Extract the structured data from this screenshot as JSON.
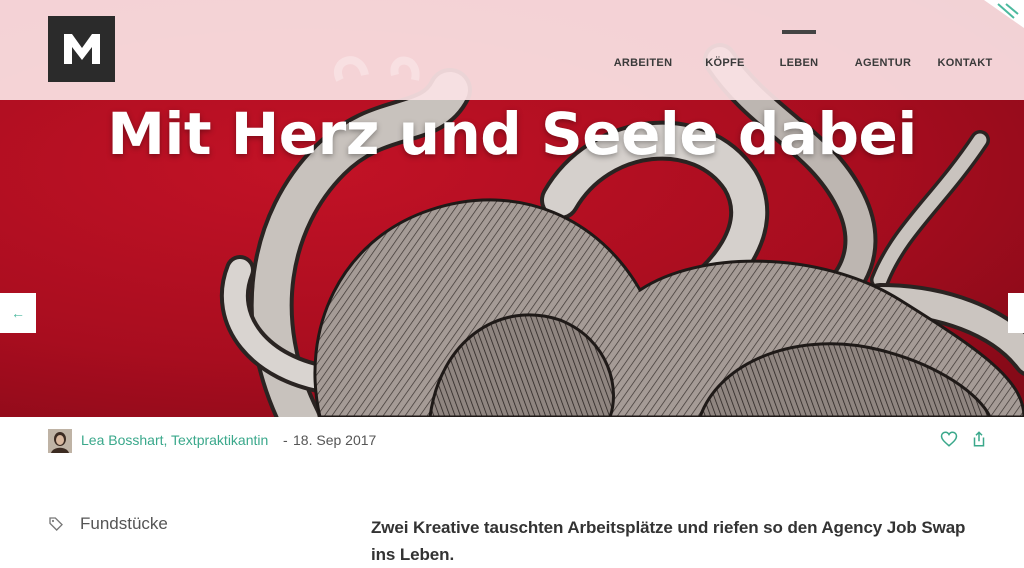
{
  "header": {
    "logo_letter": "M",
    "nav": [
      {
        "label": "ARBEITEN",
        "active": false
      },
      {
        "label": "KÖPFE",
        "active": false
      },
      {
        "label": "LEBEN",
        "active": true
      },
      {
        "label": "AGENTUR",
        "active": false
      },
      {
        "label": "KONTAKT",
        "active": false
      }
    ]
  },
  "hero": {
    "title": "Mit Herz und Seele dabei",
    "prev_arrow": "←",
    "next_arrow": "→"
  },
  "meta": {
    "author": "Lea Bosshart, Textpraktikantin",
    "separator": " - ",
    "date": "18. Sep 2017",
    "icons": [
      "heart-icon",
      "share-icon"
    ]
  },
  "content": {
    "tag": "Fundstücke",
    "lead": "Zwei Kreative tauschten Arbeitsplätze und riefen so den Agency Job Swap ins Leben."
  },
  "colors": {
    "accent": "#3aa88b",
    "hero_red": "#b10f22",
    "header_bg": "#fae2e4",
    "logo_bg": "#2b2b2b"
  }
}
